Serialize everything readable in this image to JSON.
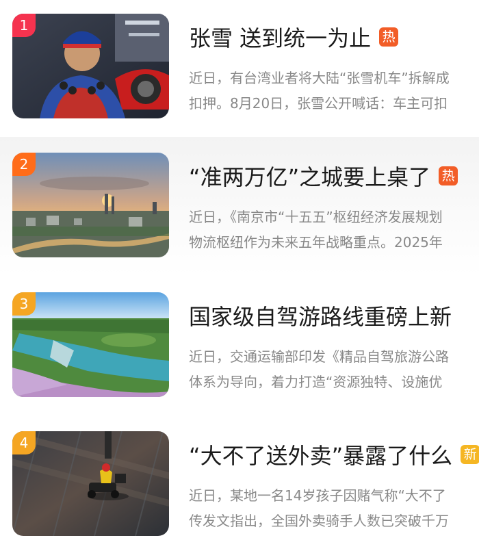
{
  "news": [
    {
      "rank": "1",
      "title": "张雪 送到统一为止",
      "badge": "热",
      "lines": [
        "近日，有台湾业者将大陆“张雪机车”拆解成",
        "扣押。8月20日，张雪公开喊话：车主可扣"
      ],
      "colors": {
        "rank": "#f5334f",
        "badge": "#f25d27"
      }
    },
    {
      "rank": "2",
      "title": "“准两万亿”之城要上桌了",
      "badge": "热",
      "lines": [
        "近日，《南京市“十五五”枢纽经济发展规划",
        "物流枢纽作为未来五年战略重点。2025年"
      ],
      "colors": {
        "rank": "#ff6c1a",
        "badge": "#f25d27"
      }
    },
    {
      "rank": "3",
      "title": "国家级自驾游路线重磅上新",
      "badge": "",
      "lines": [
        "近日，交通运输部印发《精品自驾旅游公路",
        "体系为导向，着力打造“资源独特、设施优"
      ],
      "colors": {
        "rank": "#f5a623",
        "badge": ""
      }
    },
    {
      "rank": "4",
      "title": "“大不了送外卖”暴露了什么",
      "badge": "新",
      "lines": [
        "近日，某地一名14岁孩子因赌气称“大不了",
        "传发文指出，全国外卖骑手人数已突破千万"
      ],
      "colors": {
        "rank": "#f5a623",
        "badge": "#f5b623"
      }
    }
  ]
}
